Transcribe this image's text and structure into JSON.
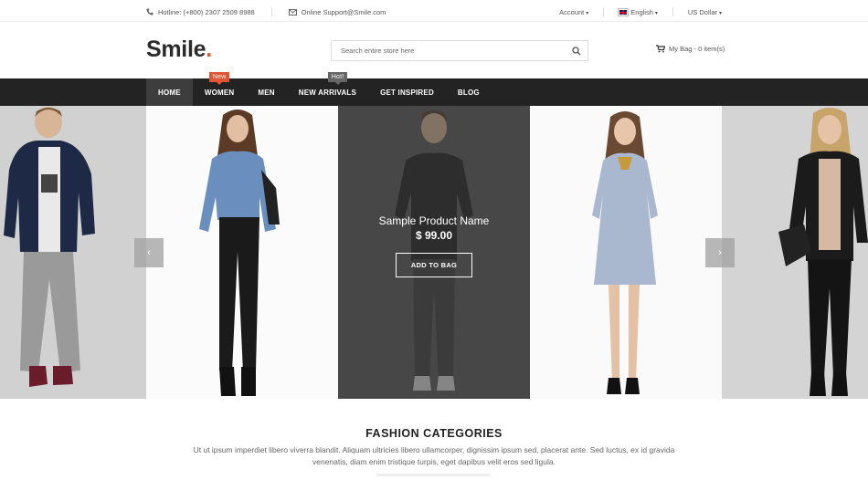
{
  "topbar": {
    "hotline": "Hotline: (+800) 2307 2509 8988",
    "email": "Online Support@Smile.com",
    "account": "Account",
    "language": "English",
    "currency": "US Dollar"
  },
  "header": {
    "logo_text": "Smile",
    "logo_dot": ".",
    "search_placeholder": "Search entire store here",
    "cart_label": "My Bag - 0 item(s)"
  },
  "nav": {
    "items": [
      {
        "label": "HOME"
      },
      {
        "label": "WOMEN",
        "badge": "New"
      },
      {
        "label": "MEN"
      },
      {
        "label": "NEW ARRIVALS",
        "badge": "Hot!"
      },
      {
        "label": "GET INSPIRED"
      },
      {
        "label": "BLOG"
      }
    ]
  },
  "slider": {
    "product_name": "Sample Product Name",
    "product_price": "$ 99.00",
    "add_to_bag": "ADD TO BAG",
    "prev_icon": "chevron-left-icon",
    "next_icon": "chevron-right-icon"
  },
  "categories": {
    "title": "FASHION CATEGORIES",
    "description": "Ut ut ipsum imperdiet libero viverra blandit. Aliquam ultricies libero ullamcorper, dignissim ipsum sed, placerat ante. Sed luctus, ex id gravida venenatis, diam enim tristique turpis, eget dapibus velit eros sed ligula."
  },
  "colors": {
    "accent": "#e15534",
    "nav_bg": "#232323",
    "nav_active": "#3d3d3d"
  }
}
